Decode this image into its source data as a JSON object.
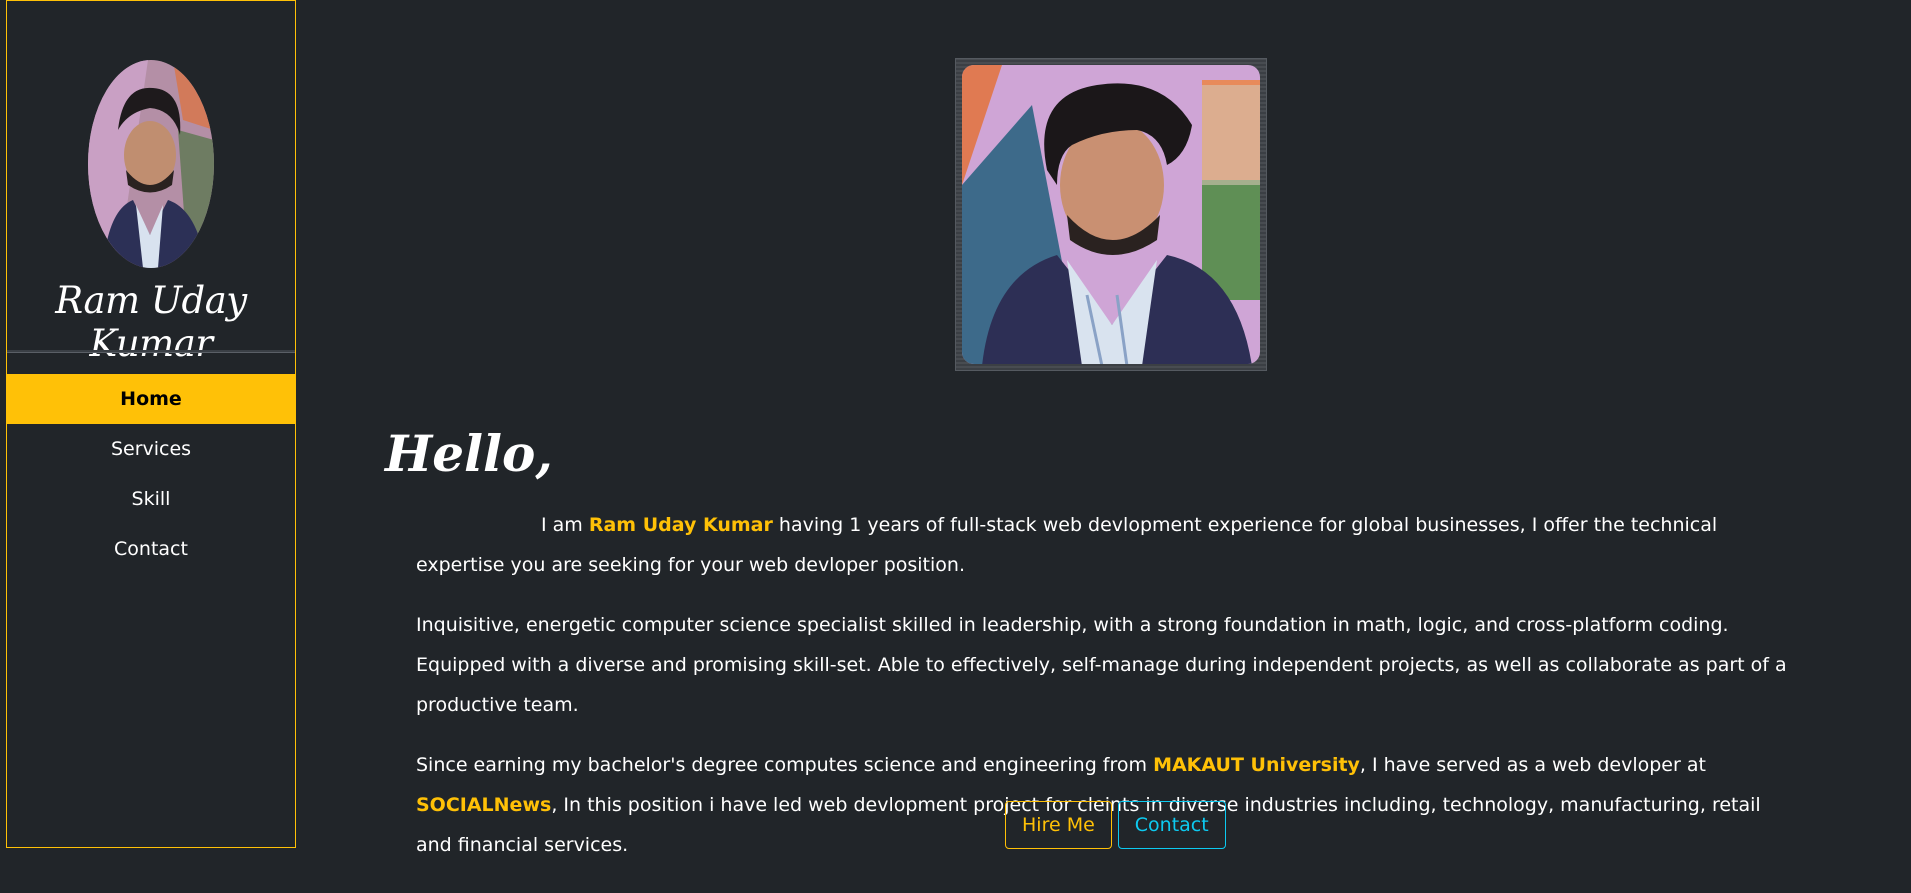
{
  "sidebar": {
    "name": "Ram Uday Kumar",
    "nav": [
      {
        "label": "Home",
        "active": true
      },
      {
        "label": "Services",
        "active": false
      },
      {
        "label": "Skill",
        "active": false
      },
      {
        "label": "Contact",
        "active": false
      }
    ]
  },
  "main": {
    "greeting": "Hello,",
    "p1": {
      "pre": "I am ",
      "name": "Ram Uday Kumar",
      "post": " having 1 years of full-stack web devlopment experience for global businesses, I offer the technical expertise you are seeking for your web devloper position."
    },
    "p2": "Inquisitive, energetic computer science specialist skilled in leadership, with a strong foundation in math, logic, and cross-platform coding. Equipped with a diverse and promising skill-set. Able to effectively, self-manage during independent projects, as well as collaborate as part of a productive team.",
    "p3": {
      "a": "Since earning my bachelor's degree computes science and engineering from ",
      "university": "MAKAUT University",
      "b": ", I have served as a web devloper at ",
      "company": "SOCIALNews",
      "c": ", In this position i have led web devlopment project for cleints in diverse industries including, technology, manufacturing, retail and financial services."
    },
    "buttons": {
      "hire": "Hire Me",
      "contact": "Contact"
    }
  },
  "colors": {
    "background": "#212529",
    "accent": "#ffc107",
    "info": "#0dcaf0"
  }
}
